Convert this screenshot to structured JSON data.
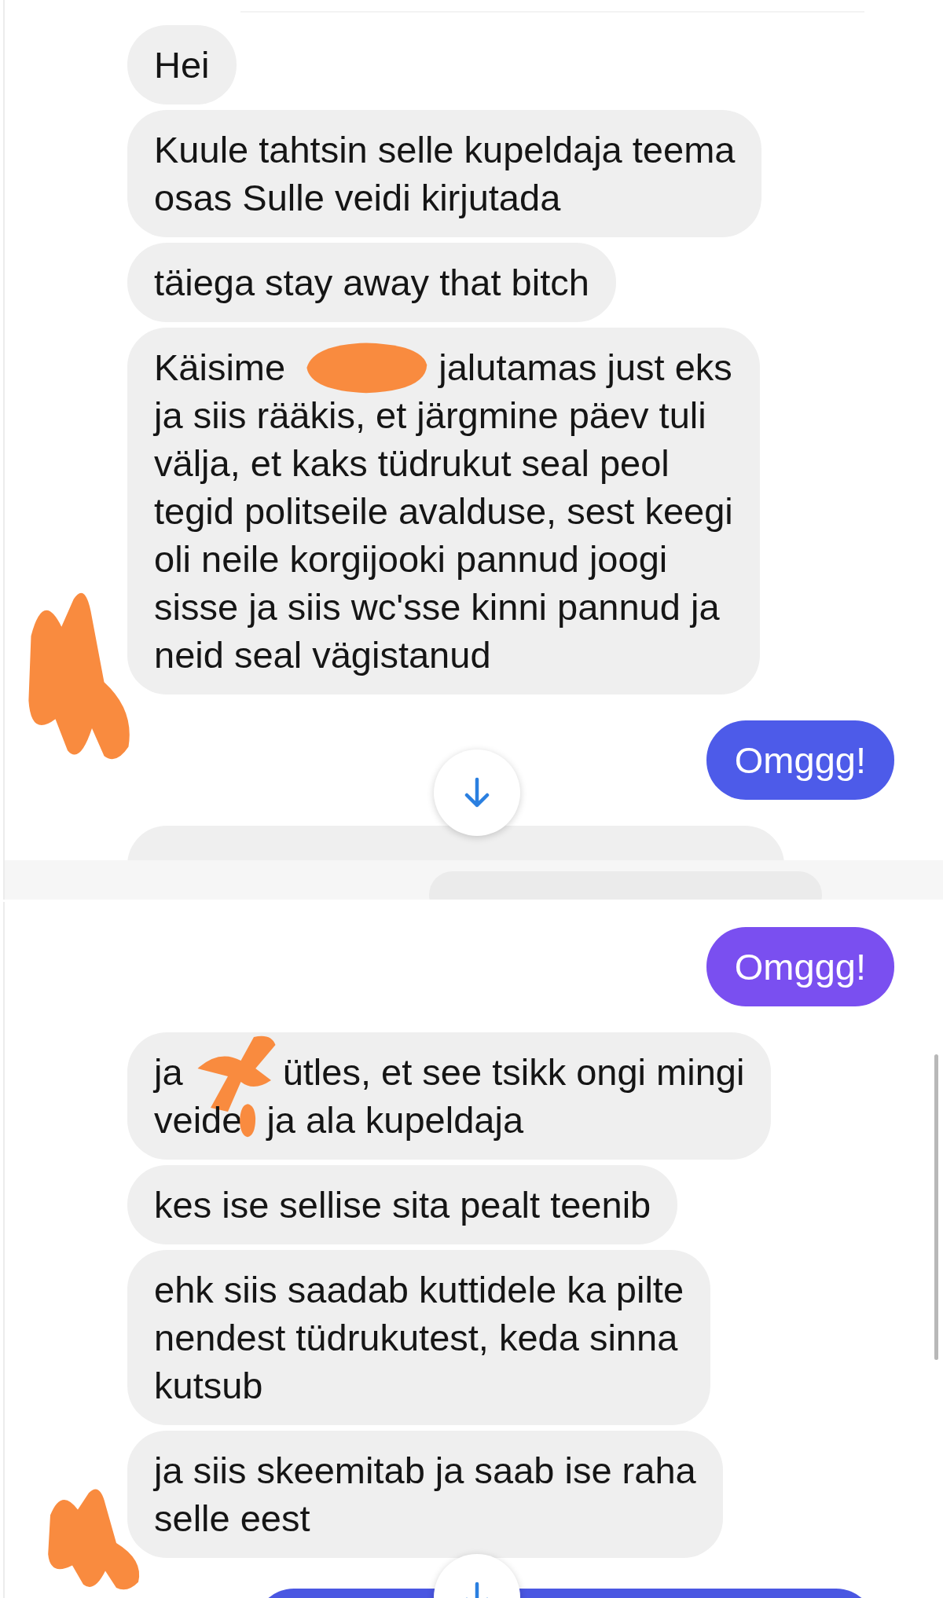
{
  "screens": [
    {
      "messages": [
        {
          "kind": "received",
          "lines": [
            [
              "Hei"
            ]
          ]
        },
        {
          "kind": "received",
          "lines": [
            [
              "Kuule tahtsin selle kupeldaja teema"
            ],
            [
              "osas Sulle veidi kirjutada"
            ]
          ]
        },
        {
          "kind": "received",
          "lines": [
            [
              "täiega stay away that bitch"
            ]
          ]
        },
        {
          "kind": "received",
          "avatar_redacted": true,
          "redacted": true,
          "lines": [
            [
              "Käisime ",
              "jalutamas just eks"
            ],
            [
              "ja siis rääkis, et järgmine päev tuli"
            ],
            [
              "välja, et kaks tüdrukut seal peol"
            ],
            [
              "tegid politseile avalduse, sest keegi"
            ],
            [
              "oli neile korgijooki pannud joogi"
            ],
            [
              "sisse ja siis wc'sse kinni pannud ja"
            ],
            [
              "neid seal vägistanud"
            ]
          ]
        },
        {
          "kind": "sent",
          "color": "#4d5be9",
          "lines": [
            [
              "Omggg!"
            ]
          ]
        },
        {
          "kind": "received_cut"
        }
      ],
      "scroll_button": true,
      "composer": true,
      "scrollbar": false
    },
    {
      "messages": [
        {
          "kind": "sent",
          "color": "#7a4ff0",
          "lines": [
            [
              "Omggg!"
            ]
          ]
        },
        {
          "kind": "received",
          "redacted": true,
          "lines": [
            [
              "ja ",
              "ütles, et see tsikk ongi mingi"
            ],
            [
              "veide",
              " ja ala kupeldaja"
            ]
          ]
        },
        {
          "kind": "received",
          "lines": [
            [
              "kes ise sellise sita pealt teenib"
            ]
          ]
        },
        {
          "kind": "received",
          "lines": [
            [
              "ehk siis saadab kuttidele ka pilte"
            ],
            [
              "nendest tüdrukutest, keda sinna"
            ],
            [
              "kutsub"
            ]
          ]
        },
        {
          "kind": "received",
          "avatar_redacted": true,
          "lines": [
            [
              "ja siis skeemitab ja saab ise raha"
            ],
            [
              "selle eest"
            ]
          ]
        },
        {
          "kind": "sent_cut",
          "color": "#4a57e2"
        }
      ],
      "scroll_button": true,
      "composer": false,
      "scrollbar": true
    }
  ]
}
